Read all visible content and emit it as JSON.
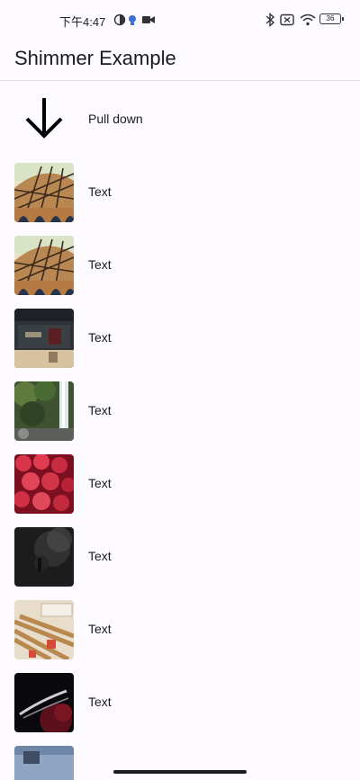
{
  "status_bar": {
    "time": "下午4:47",
    "battery": "36",
    "icons": [
      "moon-icon",
      "bulb-icon",
      "video-camera-icon",
      "bluetooth-icon",
      "no-sim-icon",
      "wifi-icon",
      "battery-icon"
    ]
  },
  "app_bar": {
    "title": "Shimmer Example"
  },
  "pull_row": {
    "label": "Pull down",
    "icon": "arrow-down-icon"
  },
  "items": [
    {
      "label": "Text",
      "image": "glass-dome-roof-image"
    },
    {
      "label": "Text",
      "image": "glass-dome-roof-image"
    },
    {
      "label": "Text",
      "image": "dark-interior-room-image"
    },
    {
      "label": "Text",
      "image": "waterfall-forest-image"
    },
    {
      "label": "Text",
      "image": "strawberries-image"
    },
    {
      "label": "Text",
      "image": "dark-smoke-image"
    },
    {
      "label": "Text",
      "image": "wooden-boards-image"
    },
    {
      "label": "Text",
      "image": "dark-abstract-red-image"
    },
    {
      "label": "",
      "image": "partial-sky-image"
    }
  ],
  "colors": {
    "background": "#fdfbff",
    "divider": "#e4e2e6",
    "text": "#1b1b1f"
  }
}
